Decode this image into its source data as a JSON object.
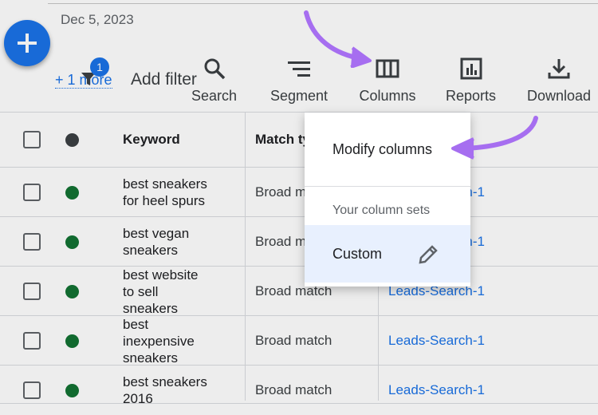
{
  "header": {
    "date": "Dec 5, 2023",
    "fab_label": "+"
  },
  "filters": {
    "more_link": "+ 1 more",
    "badge_count": "1",
    "add_filter": "Add filter"
  },
  "toolbar": {
    "search": "Search",
    "segment": "Segment",
    "columns": "Columns",
    "reports": "Reports",
    "download": "Download"
  },
  "table": {
    "headers": {
      "keyword": "Keyword",
      "match_type": "Match type"
    },
    "rows": [
      {
        "keyword_lines": [
          "best sneakers",
          "for heel spurs"
        ],
        "match_type": "Broad match",
        "ad_group": "Leads-Search-1",
        "status_color": "#137333"
      },
      {
        "keyword_lines": [
          "best vegan",
          "sneakers"
        ],
        "match_type": "Broad match",
        "ad_group": "Leads-Search-1",
        "status_color": "#137333"
      },
      {
        "keyword_lines": [
          "best website",
          "to sell",
          "sneakers"
        ],
        "match_type": "Broad match",
        "ad_group": "Leads-Search-1",
        "status_color": "#137333"
      },
      {
        "keyword_lines": [
          "best",
          "inexpensive",
          "sneakers"
        ],
        "match_type": "Broad match",
        "ad_group": "Leads-Search-1",
        "status_color": "#137333"
      },
      {
        "keyword_lines": [
          "best sneakers",
          "2016"
        ],
        "match_type": "Broad match",
        "ad_group": "Leads-Search-1",
        "status_color": "#137333"
      }
    ]
  },
  "columns_menu": {
    "modify": "Modify columns",
    "sets_header": "Your column sets",
    "custom": "Custom"
  },
  "colors": {
    "accent": "#1a73e8",
    "arrow": "#a66ef0",
    "selected_bg": "#e8f0fe"
  }
}
